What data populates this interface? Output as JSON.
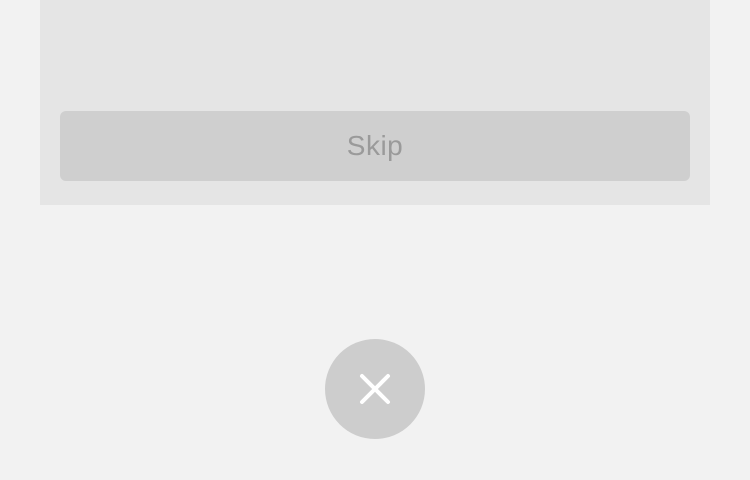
{
  "dialog": {
    "skip_label": "Skip"
  },
  "close": {
    "icon": "close-icon"
  },
  "colors": {
    "page_background": "#f2f2f2",
    "card_background": "#e5e5e5",
    "skip_button_background": "#cfcfcf",
    "skip_button_text": "#9a9a9a",
    "close_button_background": "#cdcdcd",
    "close_icon": "#ffffff"
  }
}
